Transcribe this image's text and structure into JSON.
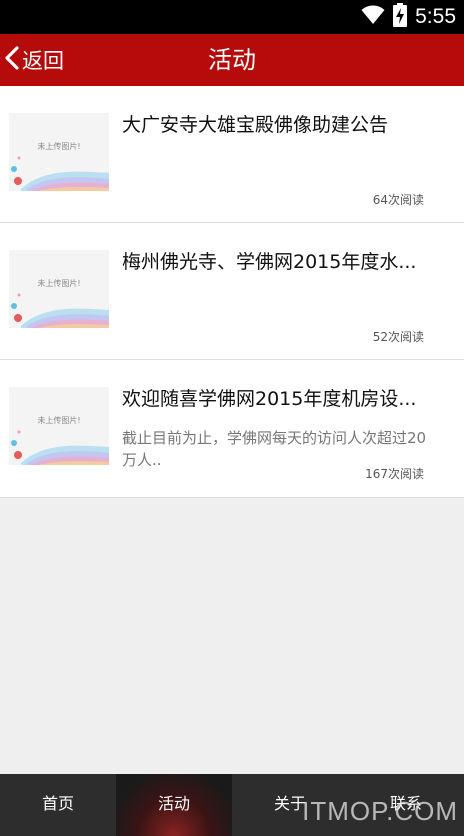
{
  "status_bar": {
    "time": "5:55",
    "icons": [
      "wifi-icon",
      "battery-charging-icon"
    ]
  },
  "header": {
    "back_label": "返回",
    "title": "活动",
    "color": "#b50b0b"
  },
  "list": {
    "placeholder_text": "未上传图片!",
    "items": [
      {
        "title": "大广安寺大雄宝殿佛像助建公告",
        "summary": "",
        "reads": "64次阅读"
      },
      {
        "title": "梅州佛光寺、学佛网2015年度水...",
        "summary": "",
        "reads": "52次阅读"
      },
      {
        "title": "欢迎随喜学佛网2015年度机房设...",
        "summary": "截止目前为止，学佛网每天的访问人次超过20万人..",
        "reads": "167次阅读"
      }
    ]
  },
  "bottom_nav": {
    "tabs": [
      {
        "label": "首页",
        "active": false
      },
      {
        "label": "活动",
        "active": true
      },
      {
        "label": "关于",
        "active": false
      },
      {
        "label": "联系",
        "active": false
      }
    ]
  },
  "watermark": "ITMOP.COM"
}
